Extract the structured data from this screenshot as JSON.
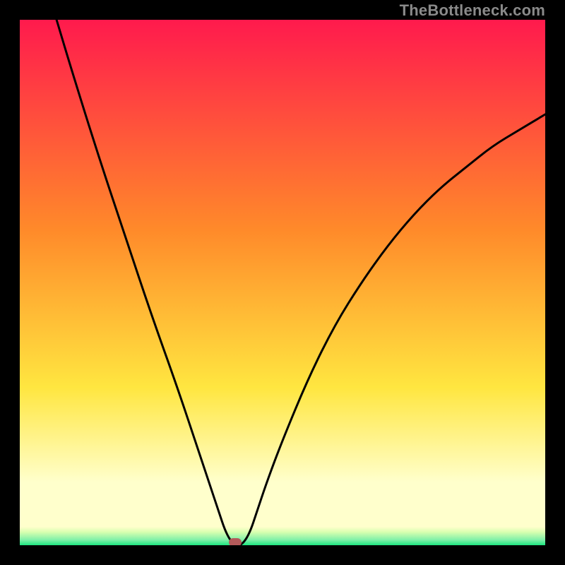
{
  "watermark": "TheBottleneck.com",
  "colors": {
    "black": "#000000",
    "red_top": "#ff1a4d",
    "orange": "#ff8a2a",
    "yellow": "#ffe640",
    "pale_yellow": "#ffffcc",
    "green": "#1de680",
    "curve": "#000000",
    "dot": "#b45a5a"
  },
  "chart_data": {
    "type": "line",
    "title": "",
    "xlabel": "",
    "ylabel": "",
    "xlim": [
      0,
      100
    ],
    "ylim": [
      0,
      100
    ],
    "x": [
      7,
      10,
      15,
      20,
      25,
      30,
      34,
      36,
      38,
      39,
      40,
      41,
      42,
      43,
      44,
      45,
      47,
      50,
      55,
      60,
      65,
      70,
      75,
      80,
      85,
      90,
      95,
      100
    ],
    "values": [
      100,
      90,
      74,
      59,
      44,
      30,
      18,
      12,
      6,
      3,
      1,
      0,
      0,
      1,
      3,
      6,
      12,
      20,
      32,
      42,
      50,
      57,
      63,
      68,
      72,
      76,
      79,
      82
    ],
    "minimum_point": {
      "x": 41,
      "y": 0
    },
    "annotations": [
      {
        "type": "dot",
        "x": 41,
        "y": 0
      }
    ],
    "background_gradient_stops": [
      {
        "pos": 0.0,
        "color": "#ff1a4d"
      },
      {
        "pos": 0.4,
        "color": "#ff8a2a"
      },
      {
        "pos": 0.7,
        "color": "#ffe640"
      },
      {
        "pos": 0.88,
        "color": "#ffffcc"
      },
      {
        "pos": 0.965,
        "color": "#ffffcc"
      },
      {
        "pos": 0.975,
        "color": "#d8ffb0"
      },
      {
        "pos": 0.99,
        "color": "#7ef0a8"
      },
      {
        "pos": 1.0,
        "color": "#1de680"
      }
    ]
  }
}
